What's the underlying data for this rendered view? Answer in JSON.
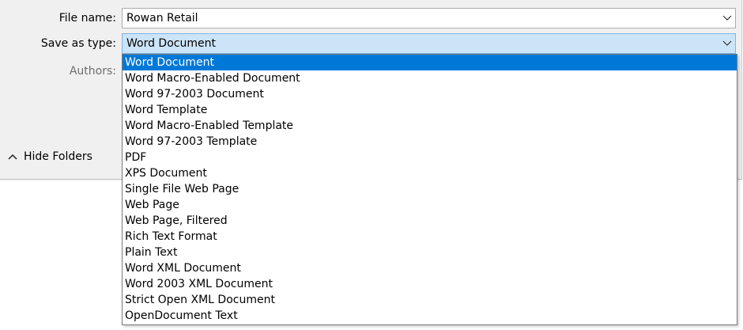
{
  "fields": {
    "file_name": {
      "label": "File name:",
      "value": "Rowan Retail"
    },
    "save_as_type": {
      "label": "Save as type:",
      "value": "Word Document"
    },
    "authors": {
      "label": "Authors:"
    }
  },
  "hide_folders": {
    "label": "Hide Folders",
    "icon": "chevron-up-icon"
  },
  "type_options": [
    "Word Document",
    "Word Macro-Enabled Document",
    "Word 97-2003 Document",
    "Word Template",
    "Word Macro-Enabled Template",
    "Word 97-2003 Template",
    "PDF",
    "XPS Document",
    "Single File Web Page",
    "Web Page",
    "Web Page, Filtered",
    "Rich Text Format",
    "Plain Text",
    "Word XML Document",
    "Word 2003 XML Document",
    "Strict Open XML Document",
    "OpenDocument Text"
  ],
  "selected_index": 0,
  "colors": {
    "selection": "#0078d7",
    "focused_combo": "#cce4f7",
    "dialog_background": "#f0f0f0"
  }
}
